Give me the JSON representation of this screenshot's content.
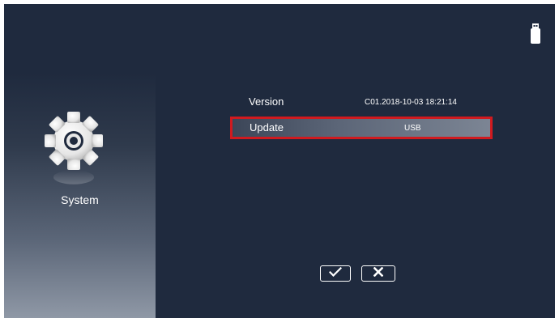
{
  "sidebar": {
    "icon": "gear-icon",
    "label": "System"
  },
  "status": {
    "usb_icon": "usb-drive-icon"
  },
  "settings": {
    "version": {
      "label": "Version",
      "value": "C01.2018-10-03 18:21:14"
    },
    "update": {
      "label": "Update",
      "value": "USB",
      "selected": true
    }
  },
  "buttons": {
    "ok_icon": "checkmark-icon",
    "cancel_icon": "x-icon"
  },
  "colors": {
    "background": "#1f2a3e",
    "selection_border": "#d01a1f"
  }
}
